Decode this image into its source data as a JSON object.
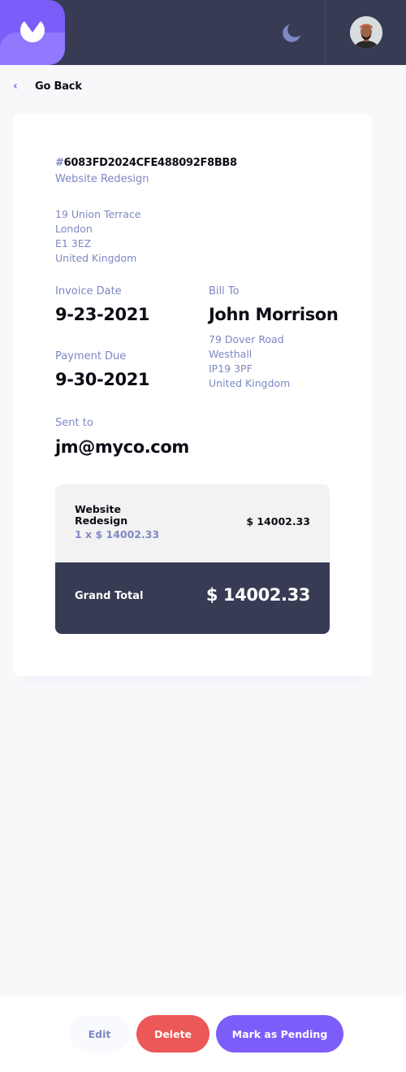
{
  "header": {
    "logo_icon": "app-logo-icon",
    "theme_icon": "moon-icon",
    "avatar_icon": "user-avatar",
    "colors": {
      "bar": "#373B53",
      "logo": "#7C5DFA",
      "logo_lower": "#9277FF"
    }
  },
  "nav": {
    "back_label": "Go Back",
    "back_icon": "chevron-left-icon"
  },
  "invoice": {
    "hash": "#",
    "id": "6083FD2024CFE488092F8BB8",
    "description": "Website Redesign",
    "sender_address": {
      "street": "19 Union Terrace",
      "city": "London",
      "post_code": "E1 3EZ",
      "country": "United Kingdom"
    },
    "invoice_date_label": "Invoice Date",
    "invoice_date": "9-23-2021",
    "payment_due_label": "Payment Due",
    "payment_due": "9-30-2021",
    "bill_to_label": "Bill To",
    "client_name": "John Morrison",
    "client_address": {
      "street": "79 Dover Road",
      "city": "Westhall",
      "post_code": "IP19 3PF",
      "country": "United Kingdom"
    },
    "sent_to_label": "Sent to",
    "client_email": "jm@myco.com",
    "items": [
      {
        "name": "Website Redesign",
        "quantity_price": "1 x $ 14002.33",
        "total": "$ 14002.33"
      }
    ],
    "grand_total_label": "Grand Total",
    "grand_total": "$ 14002.33"
  },
  "actions": {
    "edit_label": "Edit",
    "delete_label": "Delete",
    "mark_pending_label": "Mark as Pending",
    "colors": {
      "delete": "#EC5757",
      "primary": "#7C5DFA"
    }
  }
}
